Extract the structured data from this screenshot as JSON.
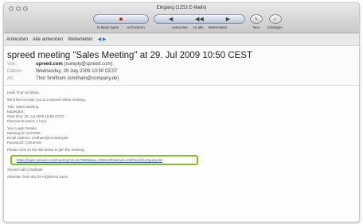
{
  "window": {
    "title": "Eingang (1253 E-Mails)"
  },
  "toolbar": {
    "items": [
      {
        "label": "E-Mails laden"
      },
      {
        "label": "Archivieren"
      },
      {
        "label": "Antworten"
      },
      {
        "label": "An alle"
      },
      {
        "label": "Weiterleiten"
      },
      {
        "label": "Neu"
      },
      {
        "label": "Erledigen"
      }
    ]
  },
  "actions": {
    "items": [
      "Antworten",
      "Alle antworten",
      "Weiterleiten"
    ]
  },
  "message": {
    "subject": "spreed meeting \"Sales Meeting\" at 29. Jul 2009 10:50 CEST",
    "from": {
      "key": "Von:",
      "sender_bold": "spreed.com",
      "sender_rest": " (noreply@spreed.com)"
    },
    "date": {
      "key": "Datum:",
      "value": "Wednesday, 29 July 2009 10:50 CEST"
    },
    "to": {
      "key": "An:",
      "value": "Thor Smitham (smitham@company.de)"
    },
    "body": {
      "greeting": "Hello Thor Smitham,",
      "intro": "We'd like to invite you to a spreed online meeting.",
      "details": [
        "Title: Sales Meeting",
        "Moderator:",
        "Start time: 29. Jul 2009 10:50 CEST",
        "Planned duration: 1 hour"
      ],
      "dialin": [
        "Your Login Details:",
        "Meeting ID: 6172899",
        "Email address: smitham@company.de",
        "Password: CNX4H0S"
      ],
      "click_text": "Please click on the link below to join the meeting:",
      "link": "https://login.spreed.com/meeting?id=6172899&pw=CNX4H0S&mail=smitham@company.de",
      "closing": "Should call to facilitate",
      "footer": "Attention: link only for registered users"
    }
  }
}
